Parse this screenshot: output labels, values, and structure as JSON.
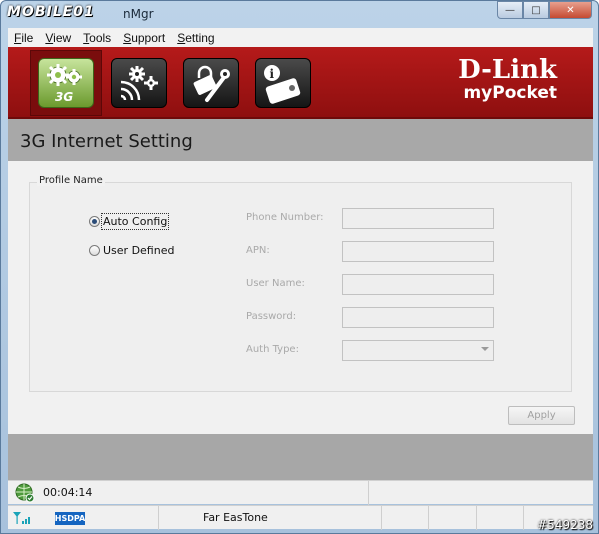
{
  "titlebar": {
    "logo_text": "MOBILE01",
    "title": "nMgr",
    "buttons": {
      "minimize": "—",
      "maximize": "□",
      "close": "✕"
    }
  },
  "menu": {
    "items": [
      {
        "label": "File",
        "accel": "F",
        "rest": "ile"
      },
      {
        "label": "View",
        "accel": "V",
        "rest": "iew"
      },
      {
        "label": "Tools",
        "accel": "T",
        "rest": "ools"
      },
      {
        "label": "Support",
        "accel": "S",
        "rest": "upport"
      },
      {
        "label": "Setting",
        "accel": "S",
        "rest": "etting"
      }
    ]
  },
  "header": {
    "nav": [
      {
        "name": "3g-settings",
        "badge": "3G",
        "active": true
      },
      {
        "name": "wireless-settings",
        "active": false
      },
      {
        "name": "tools",
        "active": false
      },
      {
        "name": "device-info",
        "active": false
      }
    ],
    "brand_main": "D-Link",
    "brand_sub": "myPocket"
  },
  "page": {
    "title": "3G Internet Setting"
  },
  "profile": {
    "legend": "Profile Name",
    "options": [
      {
        "label": "Auto Config",
        "selected": true
      },
      {
        "label": "User Defined",
        "selected": false
      }
    ],
    "fields": [
      {
        "label": "Phone Number:",
        "value": ""
      },
      {
        "label": "APN:",
        "value": ""
      },
      {
        "label": "User Name:",
        "value": ""
      },
      {
        "label": "Password:",
        "value": ""
      },
      {
        "label": "Auth Type:",
        "value": ""
      }
    ],
    "apply_label": "Apply"
  },
  "status": {
    "connection_time": "00:04:14",
    "network_type": "HSDPA",
    "carrier": "Far EasTone"
  },
  "watermark": "#549238",
  "colors": {
    "header_red": "#a51515",
    "active_green": "#7fae3c",
    "hsdpa_blue": "#1565c0"
  }
}
